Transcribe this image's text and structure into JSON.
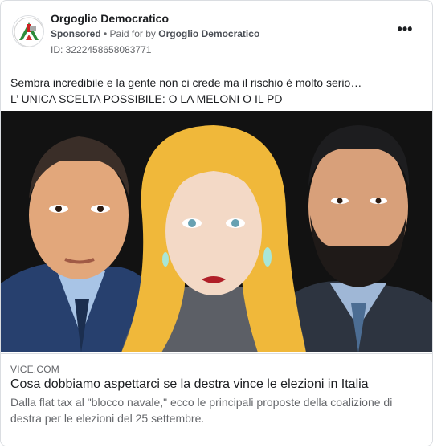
{
  "post": {
    "page_name": "Orgoglio Democratico",
    "sponsored_label": "Sponsored",
    "separator": " • ",
    "paid_for_prefix": "Paid for by ",
    "paid_for_by": "Orgoglio Democratico",
    "ad_id": "ID: 3222458658083771",
    "more_label": "•••",
    "body_line1": "Sembra incredibile e la gente non ci crede ma il rischio è molto serio…",
    "body_line2": "L’ UNICA SCELTA POSSIBILE: O LA MELONI O IL PD"
  },
  "link": {
    "domain": "VICE.COM",
    "headline": "Cosa dobbiamo aspettarci se la destra vince le elezioni in Italia",
    "description": "Dalla flat tax al \"blocco navale,\" ecco le principali proposte della coalizione di destra per le elezioni del 25 settembre."
  },
  "colors": {
    "card_border": "#dadde1",
    "secondary_text": "#65676b",
    "primary_text": "#1c1e21",
    "image_background": "#111111"
  }
}
